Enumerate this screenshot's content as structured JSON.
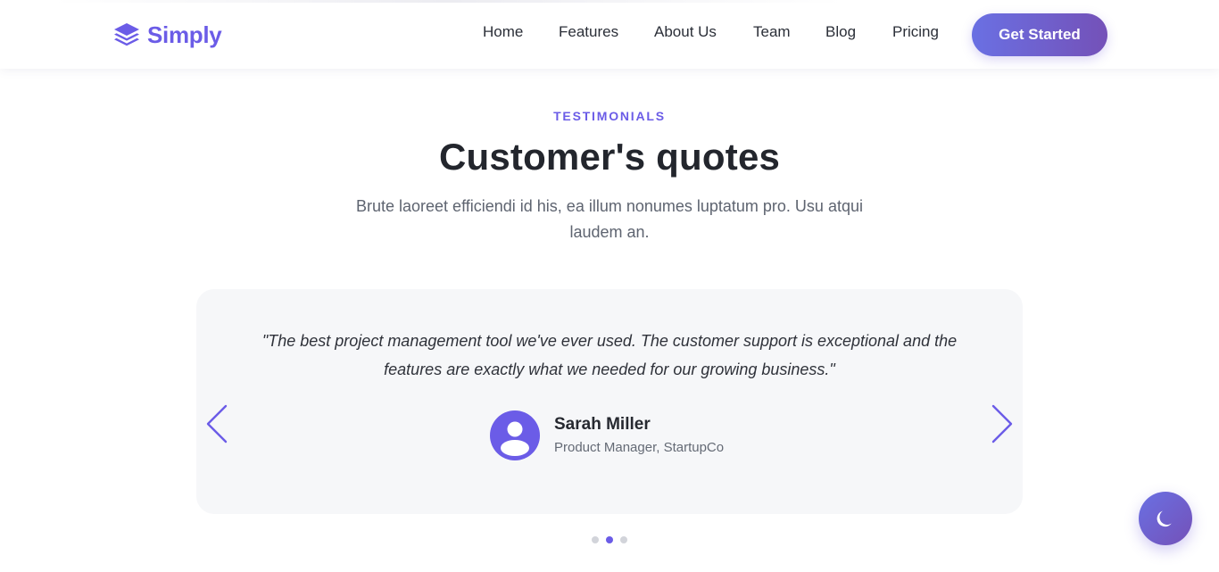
{
  "nav": {
    "brand": "Simply",
    "links": [
      "Home",
      "Features",
      "About Us",
      "Team",
      "Blog",
      "Pricing"
    ],
    "cta": "Get Started"
  },
  "section": {
    "eyebrow": "TESTIMONIALS",
    "title": "Customer's quotes",
    "subtitle": "Brute laoreet efficiendi id his, ea illum nonumes luptatum pro. Usu atqui laudem an."
  },
  "testimonial": {
    "quote": "\"The best project management tool we've ever used. The customer support is exceptional and the features are exactly what we needed for our growing business.\"",
    "name": "Sarah Miller",
    "role": "Product Manager, StartupCo"
  },
  "carousel": {
    "slide_count": 3,
    "active_slide": 2
  },
  "colors": {
    "accent": "#6b5ce7",
    "gradient_start": "#6a70e3",
    "gradient_end": "#7451b8"
  },
  "icons": {
    "brand": "layers-icon",
    "prev": "chevron-left-icon",
    "next": "chevron-right-icon",
    "avatar": "user-icon",
    "theme": "moon-icon"
  }
}
